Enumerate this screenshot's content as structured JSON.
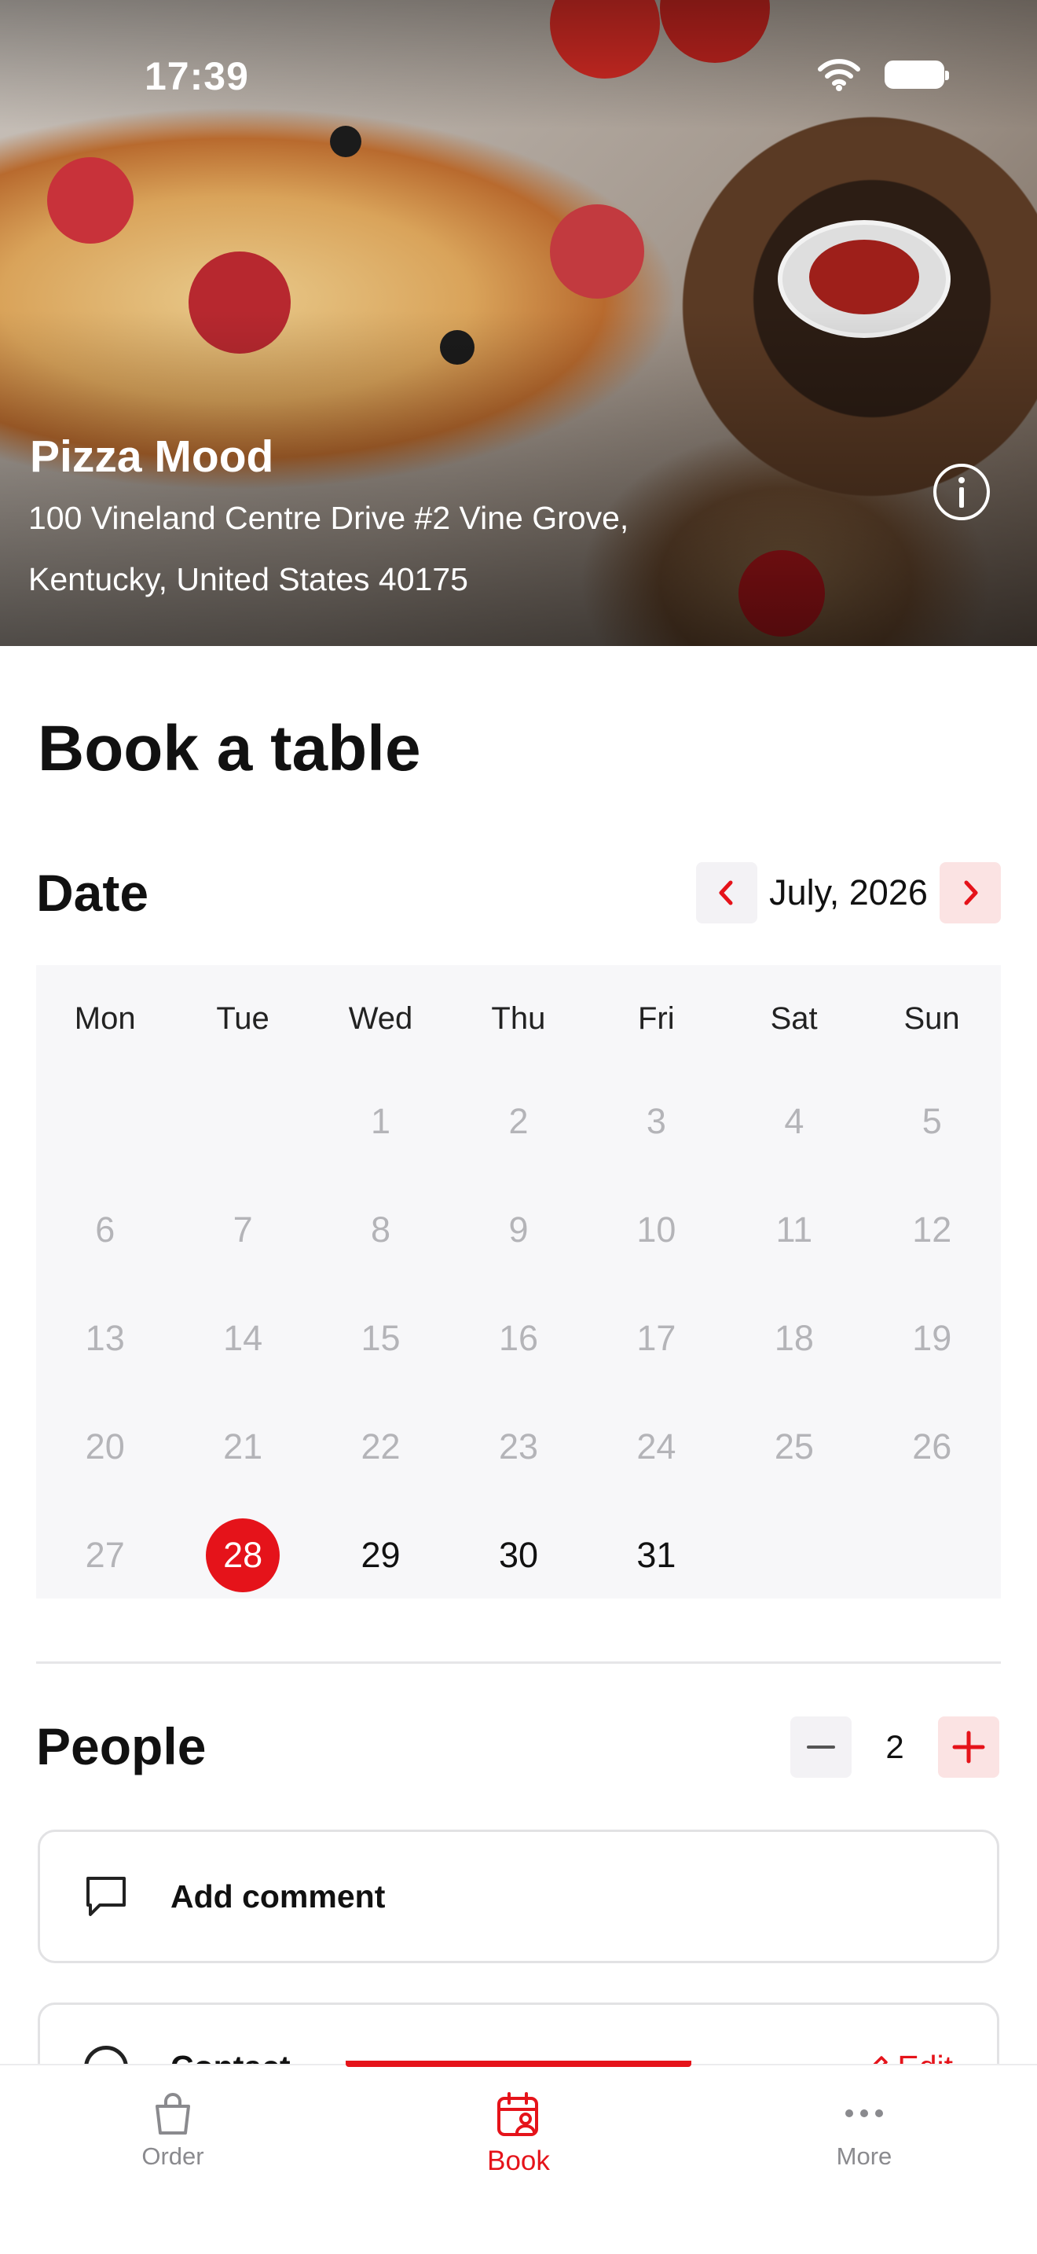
{
  "status_bar": {
    "time": "17:39"
  },
  "restaurant": {
    "name": "Pizza Mood",
    "address": "100 Vineland Centre Drive #2 Vine Grove, Kentucky, United States 40175"
  },
  "page_title": "Book a table",
  "date_section": {
    "title": "Date",
    "month_label": "July, 2026",
    "weekdays": [
      "Mon",
      "Tue",
      "Wed",
      "Thu",
      "Fri",
      "Sat",
      "Sun"
    ],
    "days": [
      {
        "label": "",
        "state": "empty"
      },
      {
        "label": "",
        "state": "empty"
      },
      {
        "label": "1",
        "state": "disabled"
      },
      {
        "label": "2",
        "state": "disabled"
      },
      {
        "label": "3",
        "state": "disabled"
      },
      {
        "label": "4",
        "state": "disabled"
      },
      {
        "label": "5",
        "state": "disabled"
      },
      {
        "label": "6",
        "state": "disabled"
      },
      {
        "label": "7",
        "state": "disabled"
      },
      {
        "label": "8",
        "state": "disabled"
      },
      {
        "label": "9",
        "state": "disabled"
      },
      {
        "label": "10",
        "state": "disabled"
      },
      {
        "label": "11",
        "state": "disabled"
      },
      {
        "label": "12",
        "state": "disabled"
      },
      {
        "label": "13",
        "state": "disabled"
      },
      {
        "label": "14",
        "state": "disabled"
      },
      {
        "label": "15",
        "state": "disabled"
      },
      {
        "label": "16",
        "state": "disabled"
      },
      {
        "label": "17",
        "state": "disabled"
      },
      {
        "label": "18",
        "state": "disabled"
      },
      {
        "label": "19",
        "state": "disabled"
      },
      {
        "label": "20",
        "state": "disabled"
      },
      {
        "label": "21",
        "state": "disabled"
      },
      {
        "label": "22",
        "state": "disabled"
      },
      {
        "label": "23",
        "state": "disabled"
      },
      {
        "label": "24",
        "state": "disabled"
      },
      {
        "label": "25",
        "state": "disabled"
      },
      {
        "label": "26",
        "state": "disabled"
      },
      {
        "label": "27",
        "state": "disabled"
      },
      {
        "label": "28",
        "state": "selected"
      },
      {
        "label": "29",
        "state": "available"
      },
      {
        "label": "30",
        "state": "available"
      },
      {
        "label": "31",
        "state": "available"
      }
    ]
  },
  "people_section": {
    "title": "People",
    "count": "2"
  },
  "comment": {
    "label": "Add comment"
  },
  "contact": {
    "label": "Contact",
    "edit_label": "Edit"
  },
  "tabs": [
    {
      "label": "Order",
      "icon": "bag-icon",
      "active": false
    },
    {
      "label": "Book",
      "icon": "calendar-person-icon",
      "active": true
    },
    {
      "label": "More",
      "icon": "more-dots-icon",
      "active": false
    }
  ],
  "colors": {
    "accent": "#e5131a",
    "accent_light": "#fbe3e3",
    "calendar_bg": "#f7f7f9",
    "muted_text": "#b4b4b8"
  }
}
